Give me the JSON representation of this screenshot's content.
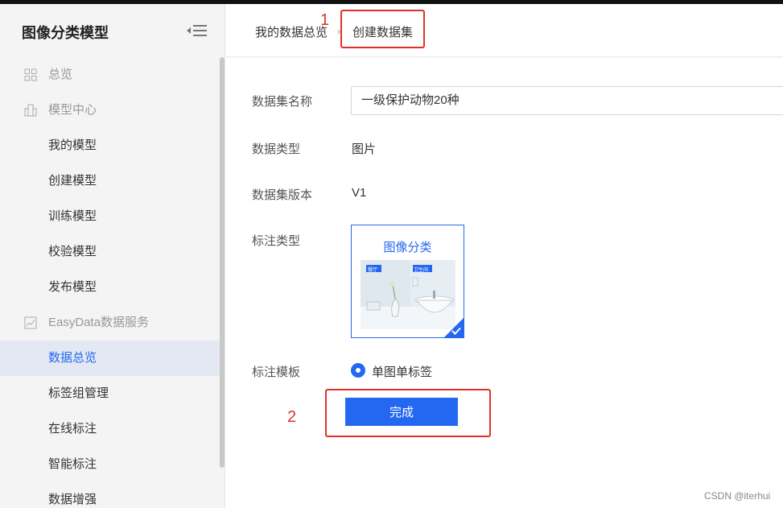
{
  "app": {
    "title": "图像分类模型"
  },
  "sidebar": {
    "items": [
      {
        "label": "总览",
        "group": true,
        "icon": "grid-icon"
      },
      {
        "label": "模型中心",
        "group": true,
        "icon": "building-icon"
      },
      {
        "label": "我的模型"
      },
      {
        "label": "创建模型"
      },
      {
        "label": "训练模型"
      },
      {
        "label": "校验模型"
      },
      {
        "label": "发布模型"
      },
      {
        "label": "EasyData数据服务",
        "group": true,
        "icon": "chart-line-icon"
      },
      {
        "label": "数据总览",
        "active": true
      },
      {
        "label": "标签组管理"
      },
      {
        "label": "在线标注"
      },
      {
        "label": "智能标注"
      },
      {
        "label": "数据增强"
      }
    ]
  },
  "breadcrumb": {
    "parent": "我的数据总览",
    "separator": "›",
    "current": "创建数据集"
  },
  "form": {
    "name_label": "数据集名称",
    "name_value": "一级保护动物20种",
    "type_label": "数据类型",
    "type_value": "图片",
    "version_label": "数据集版本",
    "version_value": "V1",
    "annotation_label": "标注类型",
    "annotation_card_title": "图像分类",
    "annotation_card_tags": [
      "餐厅",
      "卫生间"
    ],
    "template_label": "标注模板",
    "template_option": "单图单标签",
    "submit_label": "完成"
  },
  "annotations": {
    "marker1": "1",
    "marker2": "2"
  },
  "watermark": "CSDN @iterhui",
  "colors": {
    "accent": "#2468f2",
    "annotation": "#e0322b",
    "sidebar_bg": "#f4f4f4"
  }
}
